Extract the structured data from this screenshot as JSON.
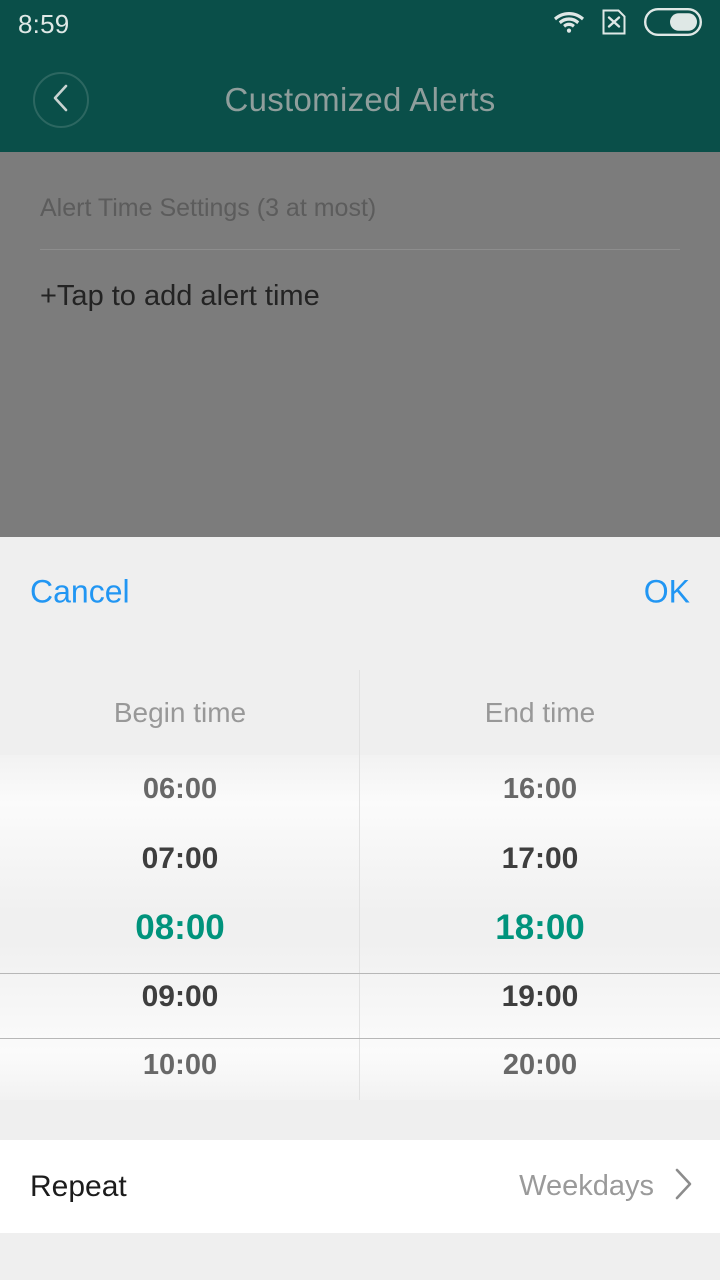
{
  "statusbar": {
    "time": "8:59",
    "icons": [
      {
        "name": "wifi-icon"
      },
      {
        "name": "sim-card-off-icon"
      },
      {
        "name": "battery-icon"
      }
    ]
  },
  "appbar": {
    "title": "Customized Alerts",
    "back_icon": "chevron-left-icon"
  },
  "background_page": {
    "section_label": "Alert Time Settings (3 at most)",
    "add_alert_label": "+Tap to add alert time"
  },
  "dialog": {
    "cancel_label": "Cancel",
    "ok_label": "OK",
    "picker": {
      "columns": [
        {
          "header": "Begin time",
          "items": [
            "06:00",
            "07:00",
            "08:00",
            "09:00",
            "10:00"
          ],
          "selected_index": 2,
          "selected_value": "08:00"
        },
        {
          "header": "End time",
          "items": [
            "16:00",
            "17:00",
            "18:00",
            "19:00",
            "20:00"
          ],
          "selected_index": 2,
          "selected_value": "18:00"
        }
      ]
    },
    "repeat": {
      "label": "Repeat",
      "value": "Weekdays",
      "chevron_icon": "chevron-right-icon"
    }
  },
  "colors": {
    "header_green": "#0a4f49",
    "accent_teal": "#00937c",
    "action_blue": "#2196f3",
    "scrim_gray": "#7c7c7c",
    "sheet_gray": "#efefef"
  }
}
